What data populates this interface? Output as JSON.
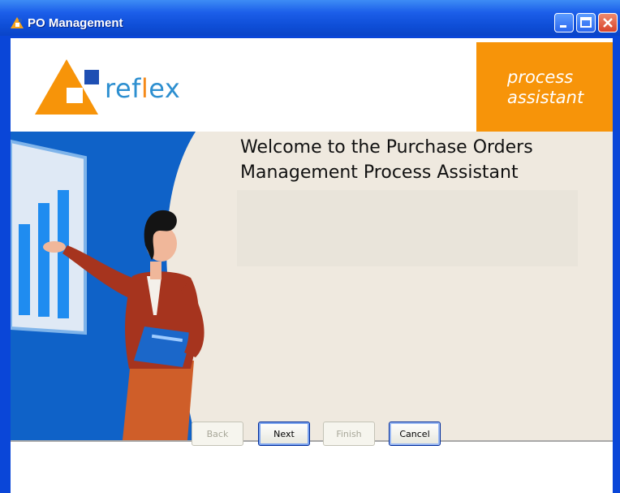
{
  "window": {
    "title": "PO Management"
  },
  "header": {
    "logo_text_prefix": "ref",
    "logo_text_accent": "l",
    "logo_text_suffix": "ex",
    "badge_line1": "process",
    "badge_line2": "assistant"
  },
  "main": {
    "welcome_line1": "Welcome to the Purchase Orders",
    "welcome_line2": "Management Process Assistant"
  },
  "buttons": {
    "back": "Back",
    "next": "Next",
    "finish": "Finish",
    "cancel": "Cancel"
  },
  "colors": {
    "titlebar": "#0a46d8",
    "accent_orange": "#f79409",
    "logo_blue": "#2d8fd0",
    "hero_background": "#efe9df",
    "hero_blue": "#0f62c8"
  },
  "icons": {
    "window": "app-triangle-icon",
    "minimize": "minimize-icon",
    "maximize": "maximize-icon",
    "close": "close-icon"
  }
}
